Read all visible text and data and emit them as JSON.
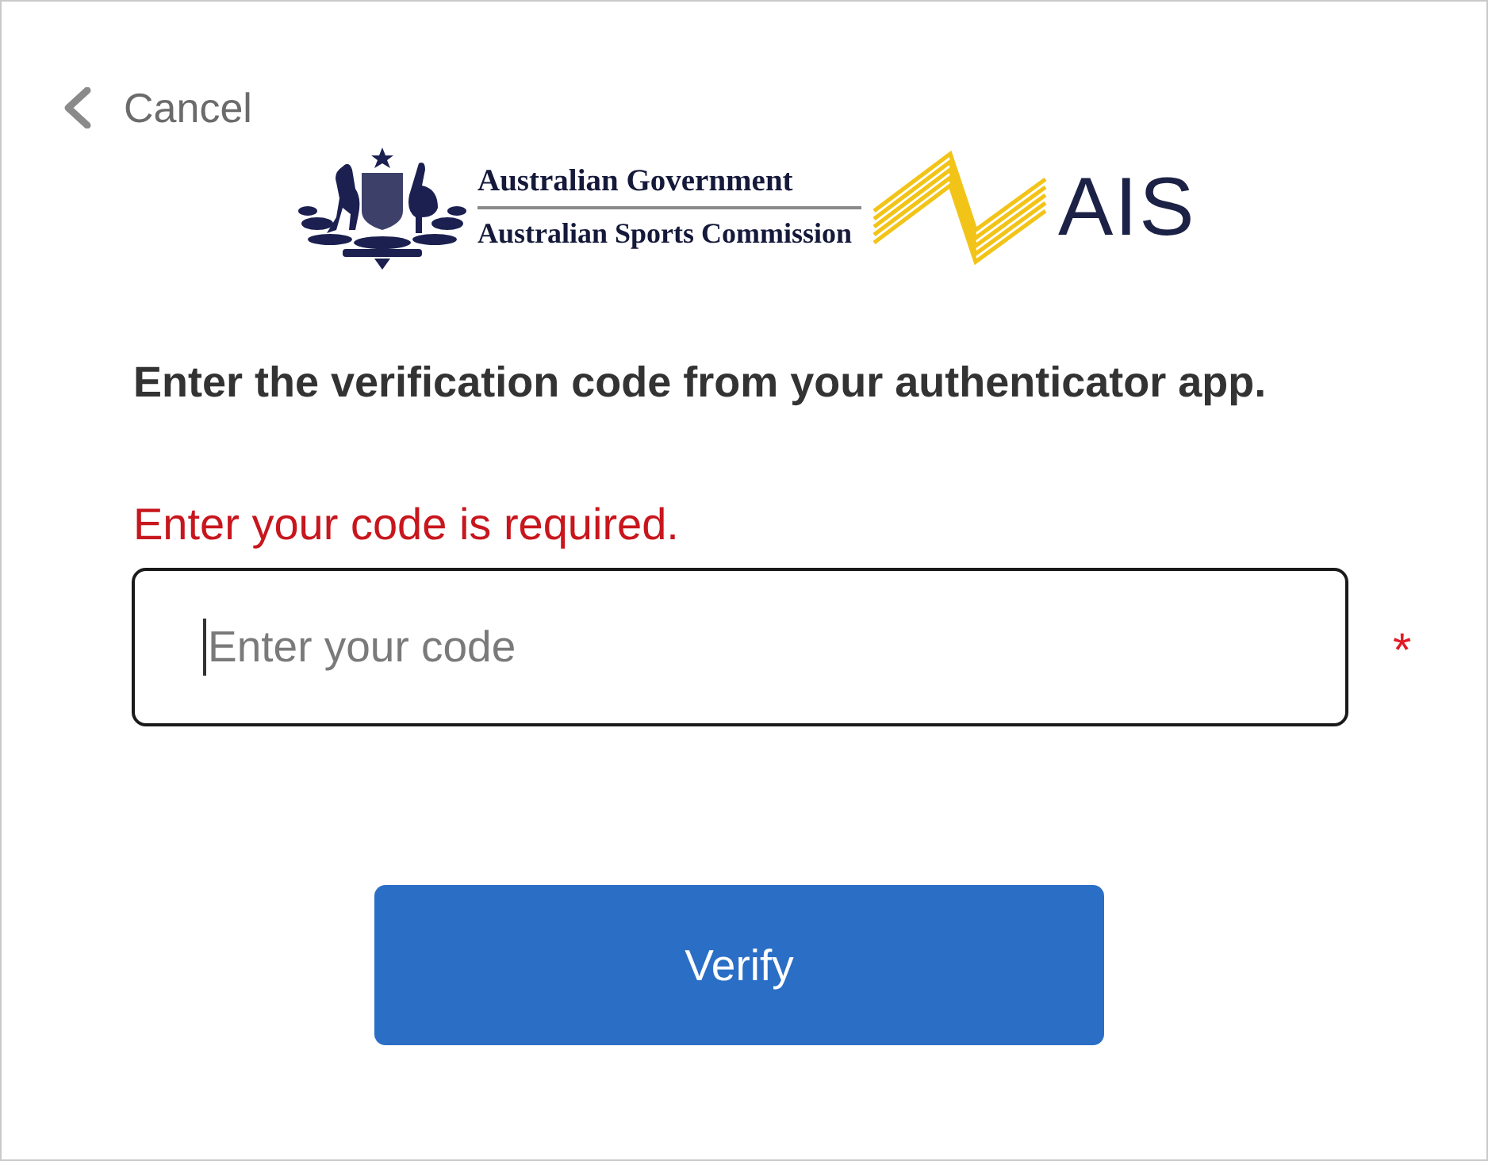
{
  "cancel_link": {
    "label": "Cancel"
  },
  "logo": {
    "government": "Australian Government",
    "agency": "Australian Sports Commission",
    "brand": "AIS"
  },
  "instruction": "Enter the verification code from your authenticator app.",
  "error": "Enter your code is required.",
  "code_field": {
    "placeholder": "Enter your code",
    "focused": true,
    "required_mark": "*"
  },
  "buttons": [
    {
      "label": "Verify"
    }
  ]
}
